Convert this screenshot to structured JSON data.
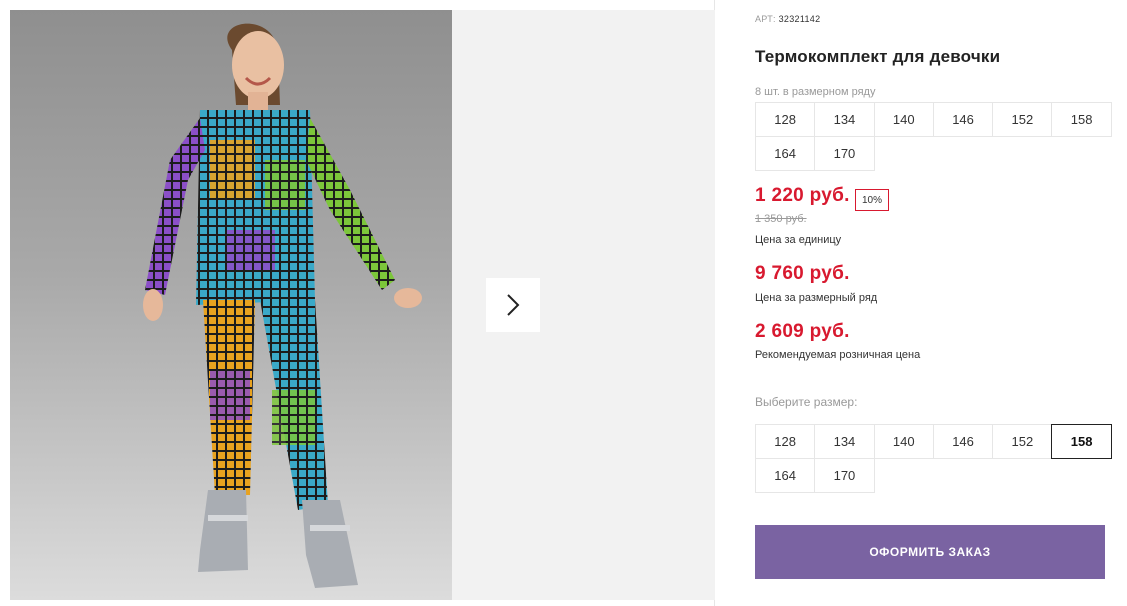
{
  "gallery": {
    "next_icon": "chevron-right-icon",
    "photo_alt": "Термокомплект для девочки"
  },
  "product": {
    "art_label": "АРТ:",
    "art_number": "32321142",
    "title": "Термокомплект для девочки",
    "pack_note": "8 шт. в размерном ряду",
    "pack_sizes": [
      "128",
      "134",
      "140",
      "146",
      "152",
      "158",
      "164",
      "170"
    ],
    "price_unit": "1 220 руб.",
    "discount_badge": "10%",
    "price_old": "1 350 руб.",
    "price_unit_label": "Цена за единицу",
    "price_row": "9 760 руб.",
    "price_row_label": "Цена за размерный ряд",
    "price_retail": "2 609 руб.",
    "price_retail_label": "Рекомендуемая розничная цена",
    "choose_size_label": "Выберите размер:",
    "size_options": [
      "128",
      "134",
      "140",
      "146",
      "152",
      "158",
      "164",
      "170"
    ],
    "selected_size": "158",
    "order_button": "ОФОРМИТЬ ЗАКАЗ"
  },
  "colors": {
    "accent_price": "#d8192f",
    "order_button_bg": "#7a63a2"
  }
}
